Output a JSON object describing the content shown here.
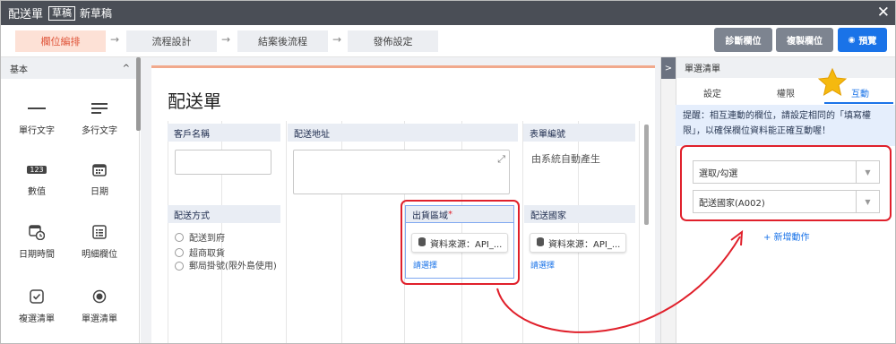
{
  "topbar": {
    "title": "配送單",
    "badge": "草稿",
    "subtitle": "新草稿",
    "close": "✕"
  },
  "steps": [
    {
      "label": "欄位編排"
    },
    {
      "label": "流程設計"
    },
    {
      "label": "結案後流程"
    },
    {
      "label": "發佈設定"
    }
  ],
  "step_arrow": "→",
  "toolbar": {
    "diagnose": "診斷欄位",
    "copy": "複製欄位",
    "preview": "預覽",
    "preview_icon": "◉"
  },
  "left": {
    "section": "基本",
    "collapse_icon": "^",
    "widgets": [
      {
        "label": "單行文字",
        "icon": "single-line-icon"
      },
      {
        "label": "多行文字",
        "icon": "multi-line-icon"
      },
      {
        "label": "數值",
        "icon": "number-icon",
        "glyph": "123"
      },
      {
        "label": "日期",
        "icon": "calendar-icon"
      },
      {
        "label": "日期時間",
        "icon": "datetime-icon"
      },
      {
        "label": "明細欄位",
        "icon": "detail-list-icon"
      },
      {
        "label": "複選清單",
        "icon": "checkbox-icon"
      },
      {
        "label": "單選清單",
        "icon": "radio-icon"
      }
    ]
  },
  "form": {
    "title": "配送單",
    "fields": {
      "customer": {
        "label": "客戶名稱"
      },
      "address": {
        "label": "配送地址",
        "expand_icon": "⤢"
      },
      "formno": {
        "label": "表單編號",
        "value": "由系統自動產生"
      },
      "method": {
        "label": "配送方式",
        "options": [
          "配送到府",
          "超商取貨",
          "郵局掛號(限外島使用)"
        ]
      },
      "region": {
        "label": "出貨區域",
        "required": "*",
        "source": "資料來源：API_...",
        "select": "請選擇"
      },
      "country": {
        "label": "配送國家",
        "source": "資料來源：API_...",
        "select": "請選擇"
      }
    }
  },
  "right": {
    "header": "單選清單",
    "expand_icon": ">",
    "tabs": [
      {
        "label": "設定"
      },
      {
        "label": "權限"
      },
      {
        "label": "互動"
      }
    ],
    "tip": "提醒：相互連動的欄位，請設定相同的「填寫權限」，以確保欄位資料能正確互動喔！",
    "select1": "選取/勾選",
    "select2": "配送國家(A002)",
    "add_action": "+ 新增動作"
  },
  "colors": {
    "accent": "#1a73e8",
    "active_step": "#e0553a",
    "highlight": "#e0202b",
    "star": "#f5b90f"
  }
}
